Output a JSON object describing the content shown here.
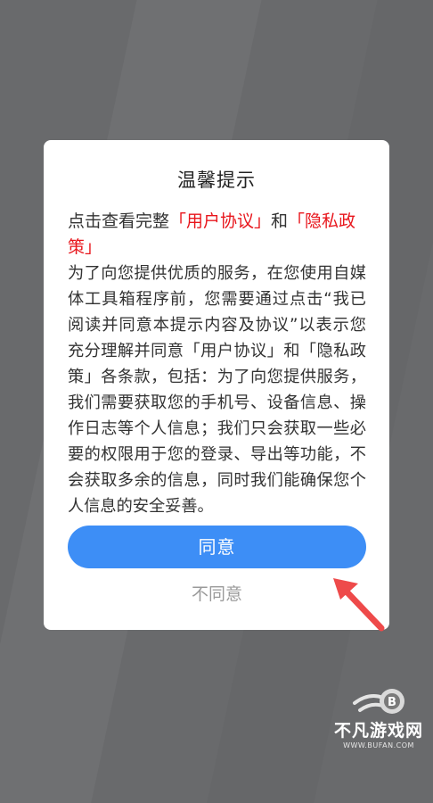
{
  "dialog": {
    "title": "温馨提示",
    "link_prefix": "点击查看完整",
    "user_agreement_link": "「用户协议」",
    "link_and": "和",
    "privacy_policy_link": "「隐私政策」",
    "body": "为了向您提供优质的服务，在您使用自媒体工具箱程序前，您需要通过点击“我已阅读并同意本提示内容及协议”以表示您充分理解并同意「用户协议」和「隐私政策」各条款，包括：为了向您提供服务，我们需要获取您的手机号、设备信息、操作日志等个人信息；我们只会获取一些必要的权限用于您的登录、导出等功能，不会获取多余的信息，同时我们能确保您个人信息的安全妥善。",
    "agree_label": "同意",
    "disagree_label": "不同意"
  },
  "watermark": {
    "name": "不凡游戏网",
    "url": "WWW.BUFAN.COM"
  },
  "colors": {
    "accent": "#3d8ef6",
    "link": "#e8161c",
    "arrow": "#ee4a4a",
    "backdrop": "#696a6c"
  }
}
